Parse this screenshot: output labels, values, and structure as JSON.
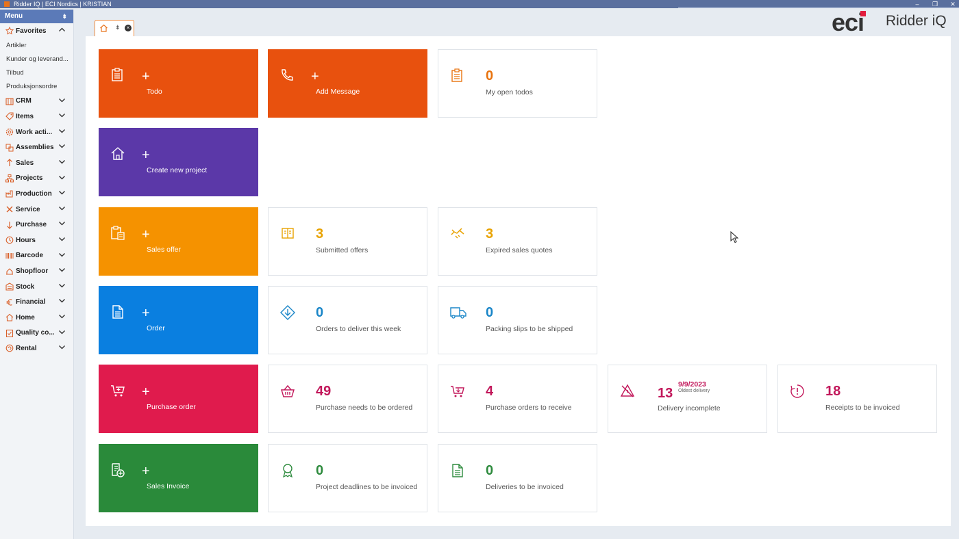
{
  "window": {
    "title": "Ridder IQ | ECI Nordics | KRISTIAN",
    "minimize": "–",
    "restore": "❐",
    "close": "✕"
  },
  "menu": {
    "header": "Menu",
    "pin": "⇟",
    "favorites": {
      "label": "Favorites",
      "items": [
        "Artikler",
        "Kunder og leverand...",
        "Tilbud",
        "Produksjonsordre"
      ]
    },
    "groups": [
      {
        "label": "CRM",
        "icon": "crm-icon"
      },
      {
        "label": "Items",
        "icon": "tag-icon"
      },
      {
        "label": "Work acti...",
        "icon": "gear-icon"
      },
      {
        "label": "Assemblies",
        "icon": "assemblies-icon"
      },
      {
        "label": "Sales",
        "icon": "arrow-up-icon"
      },
      {
        "label": "Projects",
        "icon": "hierarchy-icon"
      },
      {
        "label": "Production",
        "icon": "factory-icon"
      },
      {
        "label": "Service",
        "icon": "tools-icon"
      },
      {
        "label": "Purchase",
        "icon": "arrow-down-icon"
      },
      {
        "label": "Hours",
        "icon": "clock-icon"
      },
      {
        "label": "Barcode",
        "icon": "barcode-icon"
      },
      {
        "label": "Shopfloor",
        "icon": "shopfloor-icon"
      },
      {
        "label": "Stock",
        "icon": "stock-icon"
      },
      {
        "label": "Financial",
        "icon": "euro-icon"
      },
      {
        "label": "Home",
        "icon": "home-icon"
      },
      {
        "label": "Quality co...",
        "icon": "checklist-icon"
      },
      {
        "label": "Rental",
        "icon": "rental-icon"
      }
    ]
  },
  "tab": {
    "name": "home-tab",
    "pin": "⇟",
    "close": "×"
  },
  "brand": {
    "eci": "eci",
    "ridder": "Ridder iQ"
  },
  "colors": {
    "orange_red": "#e8510e",
    "purple": "#5b38a8",
    "amber": "#f59200",
    "blue": "#0a7fe0",
    "crimson": "#e01b4d",
    "green": "#2a8a3a",
    "stat_orange": "#e8730e",
    "stat_amber": "#e8a200",
    "stat_blue": "#1a86c8",
    "stat_crimson": "#c2185b",
    "stat_green": "#2e8b3e"
  },
  "dashboard": {
    "actions": {
      "todo": {
        "plus": "+",
        "label": "Todo"
      },
      "add_message": {
        "plus": "+",
        "label": "Add Message"
      },
      "create_project": {
        "plus": "+",
        "label": "Create new project"
      },
      "sales_offer": {
        "plus": "+",
        "label": "Sales offer"
      },
      "order": {
        "plus": "+",
        "label": "Order"
      },
      "purchase_order": {
        "plus": "+",
        "label": "Purchase order"
      },
      "sales_invoice": {
        "plus": "+",
        "label": "Sales Invoice"
      }
    },
    "stats": {
      "open_todos": {
        "value": "0",
        "label": "My open todos"
      },
      "submitted_offers": {
        "value": "3",
        "label": "Submitted offers"
      },
      "expired_quotes": {
        "value": "3",
        "label": "Expired sales quotes"
      },
      "orders_to_deliver": {
        "value": "0",
        "label": "Orders to deliver this week"
      },
      "packing_slips": {
        "value": "0",
        "label": "Packing slips to be shipped"
      },
      "purchase_needs": {
        "value": "49",
        "label": "Purchase needs to be ordered"
      },
      "purchase_receive": {
        "value": "4",
        "label": "Purchase orders to receive"
      },
      "delivery_incomplete": {
        "value": "13",
        "label": "Delivery incomplete",
        "date": "9/9/2023",
        "date_caption": "Oldest delivery"
      },
      "receipts_invoiced": {
        "value": "18",
        "label": "Receipts to be invoiced"
      },
      "project_deadlines": {
        "value": "0",
        "label": "Project deadlines to be invoiced"
      },
      "deliveries_invoiced": {
        "value": "0",
        "label": "Deliveries to be invoiced"
      }
    }
  }
}
